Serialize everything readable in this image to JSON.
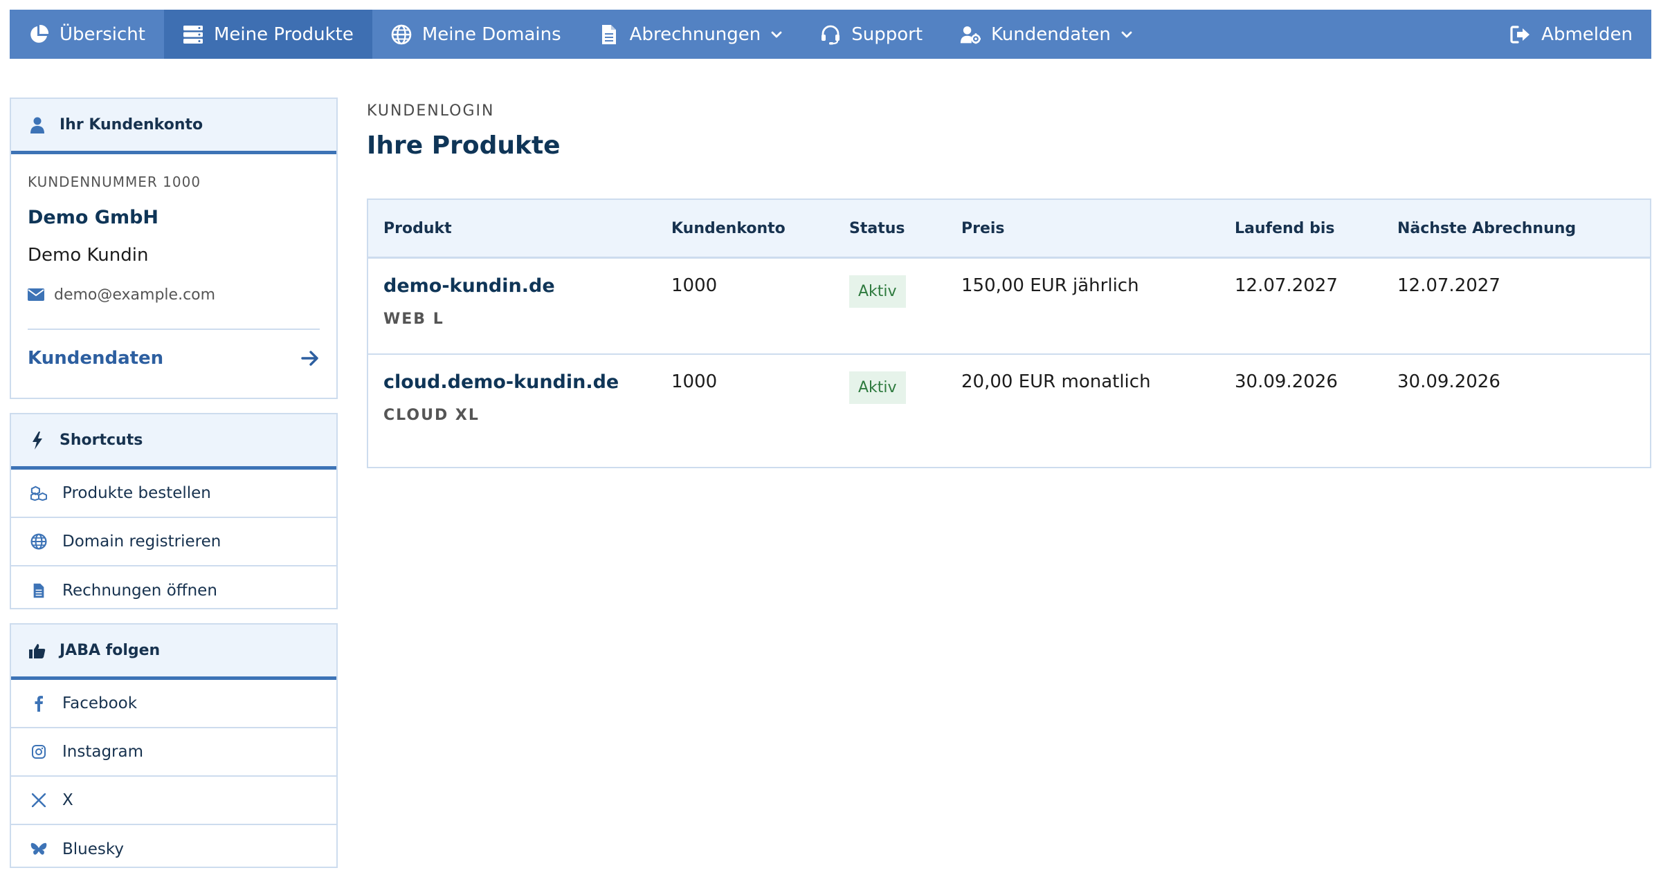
{
  "nav": {
    "items": [
      {
        "label": "Übersicht",
        "icon": "chart-pie-icon"
      },
      {
        "label": "Meine Produkte",
        "icon": "server-icon",
        "active": true
      },
      {
        "label": "Meine Domains",
        "icon": "globe-icon"
      },
      {
        "label": "Abrechnungen",
        "icon": "document-icon",
        "dropdown": true
      },
      {
        "label": "Support",
        "icon": "headset-icon"
      },
      {
        "label": "Kundendaten",
        "icon": "user-gear-icon",
        "dropdown": true
      }
    ],
    "logout_label": "Abmelden"
  },
  "account": {
    "title": "Ihr Kundenkonto",
    "customer_number_label": "KUNDENNUMMER 1000",
    "company": "Demo GmbH",
    "name": "Demo Kundin",
    "email": "demo@example.com",
    "link_label": "Kundendaten"
  },
  "shortcuts": {
    "title": "Shortcuts",
    "items": [
      {
        "label": "Produkte bestellen",
        "icon": "cubes-icon"
      },
      {
        "label": "Domain registrieren",
        "icon": "globe-icon"
      },
      {
        "label": "Rechnungen öffnen",
        "icon": "document-icon"
      }
    ]
  },
  "follow": {
    "title": "JABA folgen",
    "items": [
      {
        "label": "Facebook",
        "icon": "facebook-icon"
      },
      {
        "label": "Instagram",
        "icon": "instagram-icon"
      },
      {
        "label": "X",
        "icon": "x-icon"
      },
      {
        "label": "Bluesky",
        "icon": "bluesky-icon"
      }
    ]
  },
  "main": {
    "kicker": "KUNDENLOGIN",
    "title": "Ihre Produkte",
    "table": {
      "headers": [
        "Produkt",
        "Kundenkonto",
        "Status",
        "Preis",
        "Laufend bis",
        "Nächste Abrechnung"
      ],
      "rows": [
        {
          "product": "demo-kundin.de",
          "plan": "WEB L",
          "account": "1000",
          "status": "Aktiv",
          "price": "150,00 EUR jährlich",
          "until": "12.07.2027",
          "next_billing": "12.07.2027"
        },
        {
          "product": "cloud.demo-kundin.de",
          "plan": "CLOUD XL",
          "account": "1000",
          "status": "Aktiv",
          "price": "20,00 EUR monatlich",
          "until": "30.09.2026",
          "next_billing": "30.09.2026"
        }
      ]
    }
  },
  "colors": {
    "nav_bg": "#5382c3",
    "nav_active": "#3e6fb2",
    "accent": "#3d73b6",
    "badge_bg": "#e6f3ea",
    "badge_text": "#2e7a3e"
  }
}
